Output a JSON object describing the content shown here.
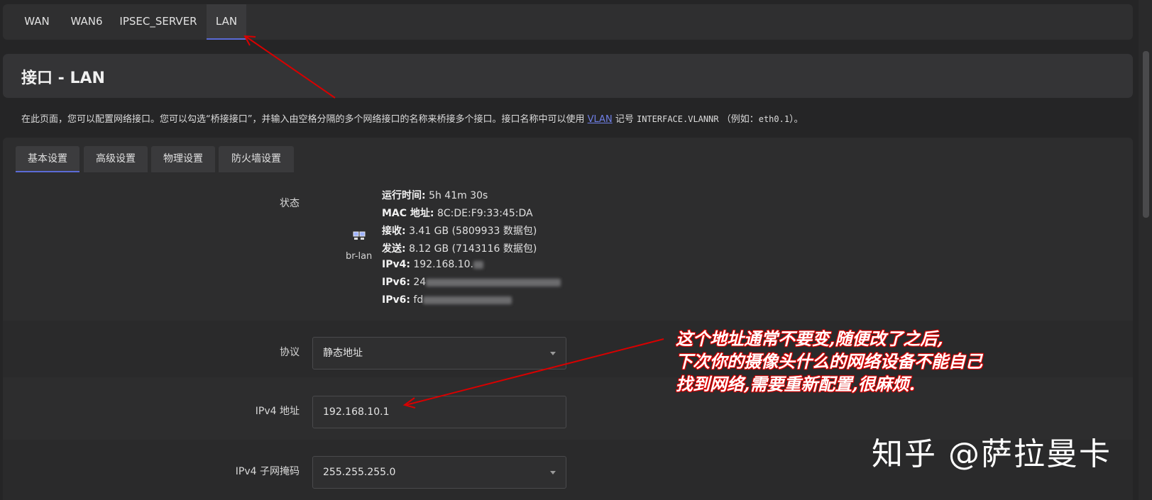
{
  "top_tabs": [
    "WAN",
    "WAN6",
    "IPSEC_SERVER",
    "LAN"
  ],
  "active_top_tab": "LAN",
  "page_title": "接口 - LAN",
  "description": {
    "text_before": "在此页面，您可以配置网络接口。您可以勾选“桥接接口”，并输入由空格分隔的多个网络接口的名称来桥接多个接口。接口名称中可以使用",
    "link": "VLAN",
    "text_mid": "记号",
    "code1": "INTERFACE.VLANNR",
    "text_example": "（例如：",
    "code2": "eth0.1",
    "text_after": "）。"
  },
  "sub_tabs": [
    "基本设置",
    "高级设置",
    "物理设置",
    "防火墙设置"
  ],
  "status": {
    "label": "状态",
    "interface_name": "br-lan",
    "uptime_label": "运行时间:",
    "uptime": "5h 41m 30s",
    "mac_label": "MAC 地址:",
    "mac": "8C:DE:F9:33:45:DA",
    "rx_label": "接收:",
    "rx": "3.41 GB (5809933 数据包)",
    "tx_label": "发送:",
    "tx": "8.12 GB (7143116 数据包)",
    "ipv4_label": "IPv4:",
    "ipv4": "192.168.10.",
    "ipv6_label_1": "IPv6:",
    "ipv6_1": "24",
    "ipv6_label_2": "IPv6:",
    "ipv6_2": "fd"
  },
  "protocol": {
    "label": "协议",
    "value": "静态地址"
  },
  "ipv4_address": {
    "label": "IPv4 地址",
    "value": "192.168.10.1"
  },
  "ipv4_netmask": {
    "label": "IPv4 子网掩码",
    "value": "255.255.255.0"
  },
  "annotation": [
    "这个地址通常不要变,随便改了之后,",
    "下次你的摄像头什么的网络设备不能自己",
    "找到网络,需要重新配置,很麻烦."
  ],
  "watermark": "知乎 @萨拉曼卡",
  "colors": {
    "accent": "#5b6bd6",
    "annotation_red": "#d80000",
    "background": "#252526"
  }
}
